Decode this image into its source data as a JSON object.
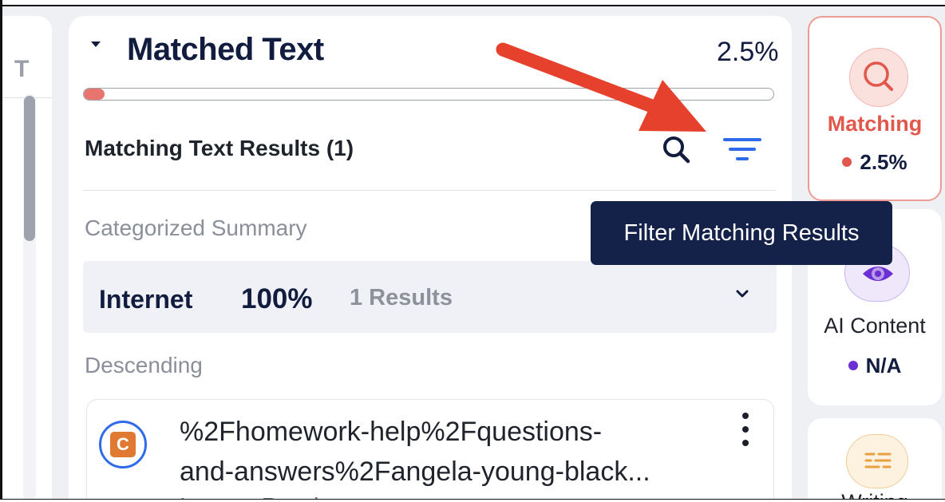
{
  "left_panel": {
    "partial_letter": "T"
  },
  "matched": {
    "title": "Matched Text",
    "percent": "2.5%",
    "progress_fraction": 0.025
  },
  "results": {
    "heading": "Matching Text Results (1)",
    "search_icon": "search-icon",
    "filter_icon": "filter-icon"
  },
  "summary": {
    "label": "Categorized Summary",
    "internet": {
      "name": "Internet",
      "percent": "100%",
      "count": "1 Results"
    }
  },
  "sort": {
    "label": "Descending"
  },
  "result_item": {
    "badge_letter": "C",
    "line1": "%2Fhomework-help%2Fquestions-",
    "line2": "and-answers%2Fangela-young-black...",
    "line3": "Internet Result"
  },
  "tooltip": {
    "text": "Filter Matching Results"
  },
  "side_cards": {
    "matching": {
      "label": "Matching",
      "value": "2.5%",
      "color": "#e2574c"
    },
    "ai_content": {
      "label": "AI Content",
      "value": "N/A",
      "color": "#6b2fd3"
    },
    "writing": {
      "label": "Writing"
    }
  },
  "annotation": {
    "arrow_color": "#e5412d"
  }
}
